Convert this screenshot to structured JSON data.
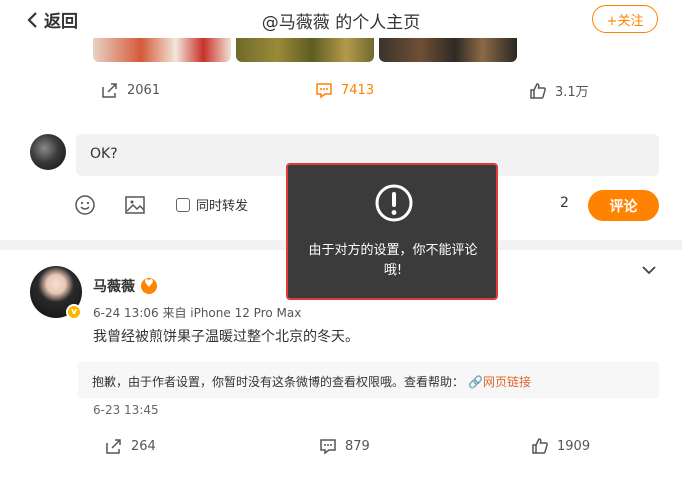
{
  "header": {
    "back_label": "返回",
    "title": "@马薇薇 的个人主页",
    "follow_label": "+关注"
  },
  "post1": {
    "actions": {
      "repost": "2061",
      "comment": "7413",
      "like": "3.1万"
    }
  },
  "composer": {
    "input_value": "OK?",
    "repost_label": "同时转发",
    "count": "2",
    "submit_label": "评论"
  },
  "toast": {
    "message": "由于对方的设置，你不能评论哦!"
  },
  "post2": {
    "username": "马薇薇",
    "meta": "6-24 13:06 来自 iPhone 12 Pro Max",
    "text": "我曾经被煎饼果子温暖过整个北京的冬天。",
    "notice_text": "抱歉，由于作者设置，你暂时没有这条微博的查看权限哦。查看帮助：",
    "notice_link": "网页链接",
    "date": "6-23 13:45",
    "actions": {
      "repost": "264",
      "comment": "879",
      "like": "1909"
    }
  },
  "colors": {
    "accent": "#ff8200",
    "toast_border": "#e03a3a"
  }
}
